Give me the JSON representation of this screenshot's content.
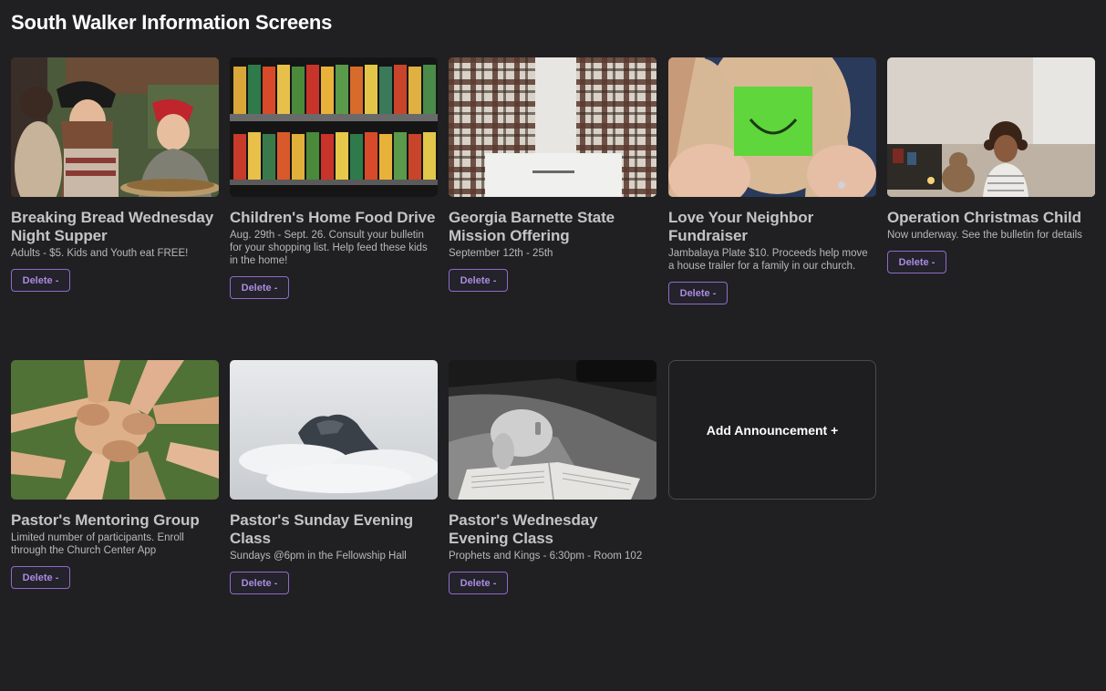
{
  "header": {
    "title": "South Walker Information Screens"
  },
  "cards": [
    {
      "title": "Breaking Bread Wednesday Night Supper",
      "description": "Adults - $5. Kids and Youth eat FREE!",
      "delete_label": "Delete -"
    },
    {
      "title": "Children's Home Food Drive",
      "description": "Aug. 29th - Sept. 26. Consult your bulletin for your shopping list. Help feed these kids in the home!",
      "delete_label": "Delete -"
    },
    {
      "title": "Georgia Barnette State Mission Offering",
      "description": "September 12th - 25th",
      "delete_label": "Delete -"
    },
    {
      "title": "Love Your Neighbor Fundraiser",
      "description": "Jambalaya Plate $10. Proceeds help move a house trailer for a family in our church.",
      "delete_label": "Delete -"
    },
    {
      "title": "Operation Christmas Child",
      "description": "Now underway. See the bulletin for details",
      "delete_label": "Delete -"
    },
    {
      "title": "Pastor's Mentoring Group",
      "description": "Limited number of participants. Enroll through the Church Center App",
      "delete_label": "Delete -"
    },
    {
      "title": "Pastor's Sunday Evening Class",
      "description": "Sundays @6pm in the Fellowship Hall",
      "delete_label": "Delete -"
    },
    {
      "title": "Pastor's Wednesday Evening Class",
      "description": "Prophets and Kings - 6:30pm - Room 102",
      "delete_label": "Delete -"
    }
  ],
  "add_card": {
    "label": "Add Announcement +"
  },
  "colors": {
    "background": "#202022",
    "title_text": "#c4c4c4",
    "accent_purple": "#8f6bc9",
    "button_text": "#a98be0"
  }
}
